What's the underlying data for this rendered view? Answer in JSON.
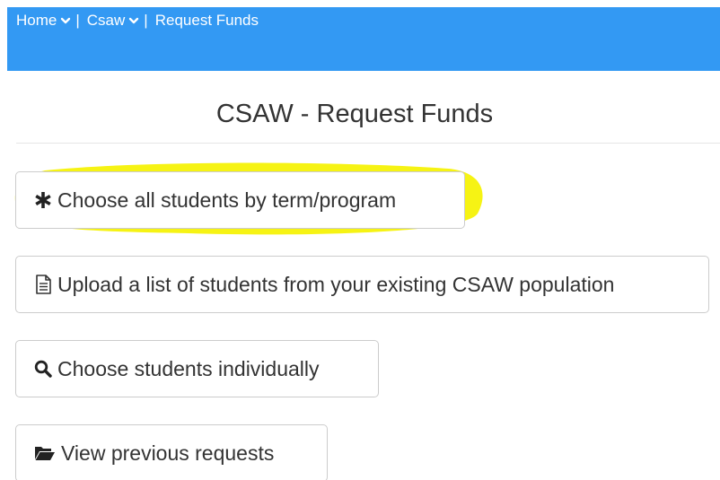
{
  "nav": {
    "breadcrumb": [
      {
        "label": "Home",
        "has_dropdown": true
      },
      {
        "label": "Csaw",
        "has_dropdown": true
      },
      {
        "label": "Request Funds",
        "has_dropdown": false
      }
    ],
    "separator": "|"
  },
  "page": {
    "title": "CSAW - Request Funds"
  },
  "actions": [
    {
      "label": "Choose all students by term/program",
      "icon": "asterisk-icon"
    },
    {
      "label": "Upload a list of students from your existing CSAW population",
      "icon": "document-icon"
    },
    {
      "label": "Choose students individually",
      "icon": "search-icon"
    },
    {
      "label": "View previous requests",
      "icon": "folder-open-icon"
    }
  ],
  "colors": {
    "nav_bg": "#3399f3",
    "highlight": "#f5f200",
    "text": "#333333",
    "border": "#cccccc"
  }
}
